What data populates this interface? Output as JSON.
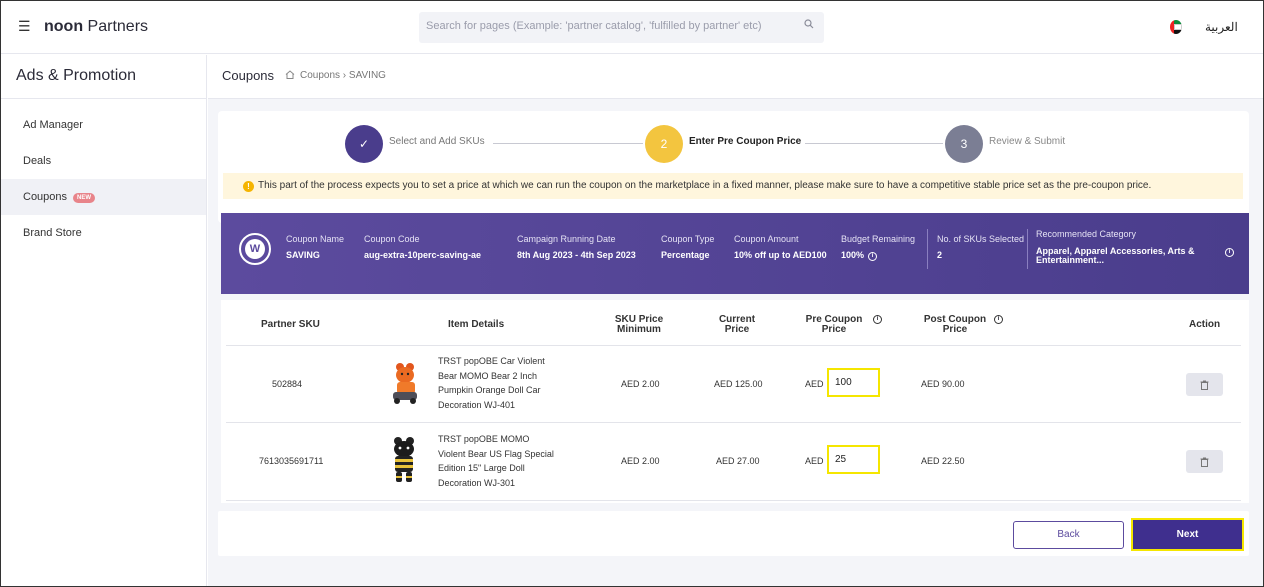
{
  "topbar": {
    "menu_icon": "hamburger-icon",
    "brand_bold": "noon",
    "brand_rest": "Partners",
    "search_placeholder": "Search for pages (Example: 'partner catalog', 'fulfilled by partner' etc)",
    "search_icon": "search-icon",
    "language": "العربية"
  },
  "sidebar": {
    "title": "Ads & Promotion",
    "items": [
      {
        "label": "Ad Manager"
      },
      {
        "label": "Deals"
      },
      {
        "label": "Coupons",
        "badge": "NEW"
      },
      {
        "label": "Brand Store"
      }
    ]
  },
  "breadcrumb": {
    "title": "Coupons",
    "path": "Coupons  ›  SAVING"
  },
  "stepper": {
    "steps": [
      {
        "num": "✓",
        "label": "Select and Add SKUs",
        "color": "#4a3d8c"
      },
      {
        "num": "2",
        "label": "Enter Pre Coupon Price",
        "color": "#f3c53f"
      },
      {
        "num": "3",
        "label": "Review & Submit",
        "color": "#7b7e94"
      }
    ],
    "notice": "This part of the process expects you to set a price at which we can run the coupon on the marketplace in a fixed manner, please make sure to have a competitive stable price set as the pre-coupon price."
  },
  "coupon": {
    "name_label": "Coupon Name",
    "name": "SAVING",
    "code_label": "Coupon Code",
    "code": "aug-extra-10perc-saving-ae",
    "date_label": "Campaign Running Date",
    "date": "8th Aug 2023 - 4th Sep 2023",
    "type_label": "Coupon Type",
    "type": "Percentage",
    "amount_label": "Coupon Amount",
    "amount": "10% off up to AED100",
    "budget_label": "Budget Remaining",
    "budget": "100%",
    "skus_label": "No. of SKUs Selected",
    "skus": "2",
    "category_label": "Recommended Category",
    "category": "Apparel, Apparel Accessories, Arts & Entertainment..."
  },
  "table": {
    "headers": {
      "sku": "Partner SKU",
      "details": "Item Details",
      "min1": "SKU Price",
      "min2": "Minimum",
      "cur1": "Current",
      "cur2": "Price",
      "pre1": "Pre Coupon",
      "pre2": "Price",
      "post1": "Post Coupon",
      "post2": "Price",
      "action": "Action"
    },
    "rows": [
      {
        "sku": "502884",
        "desc": "TRST popOBE Car Violent Bear MOMO Bear 2 Inch Pumpkin Orange Doll Car Decoration WJ-401",
        "min": "AED 2.00",
        "current": "AED 125.00",
        "currency": "AED",
        "pre": "100",
        "post": "AED 90.00"
      },
      {
        "sku": "7613035691711",
        "desc": "TRST popOBE MOMO Violent Bear US Flag Special Edition 15\" Large Doll Decoration WJ-301",
        "min": "AED 2.00",
        "current": "AED 27.00",
        "currency": "AED",
        "pre": "25",
        "post": "AED 22.50"
      }
    ]
  },
  "footer": {
    "back": "Back",
    "next": "Next"
  }
}
